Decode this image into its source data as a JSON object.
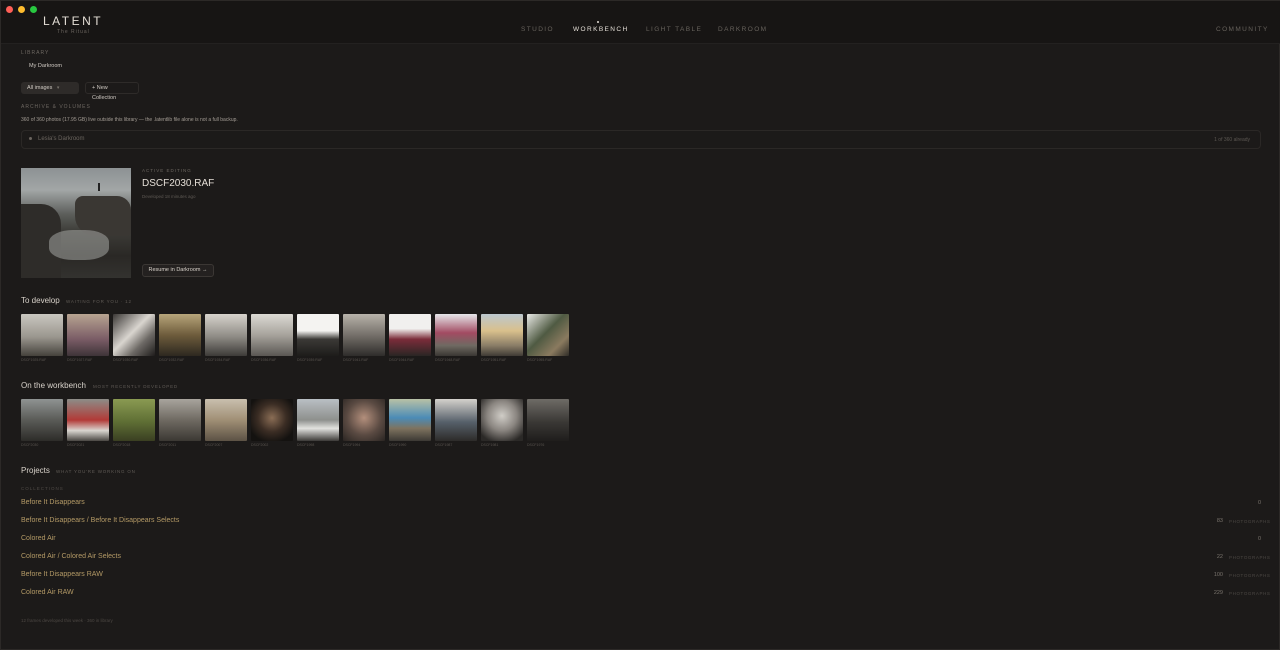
{
  "app": {
    "name": "LATENT",
    "subtitle": "The Ritual"
  },
  "nav": {
    "items": [
      "STUDIO",
      "WORKBENCH",
      "LIGHT TABLE",
      "DARKROOM"
    ],
    "active": "WORKBENCH",
    "right": "COMMUNITY"
  },
  "library": {
    "label": "LIBRARY",
    "selected": "My Darkroom",
    "filter": "All images",
    "new_collection": "+ New Collection"
  },
  "archive": {
    "label": "ARCHIVE & VOLUMES",
    "note": "360 of 360 photos (17.95 GB) live outside this library — the .latentlib file alone is not a full backup.",
    "volume_name": "Lesia's Darkroom",
    "volume_count": "1 of 360 already"
  },
  "active": {
    "label": "ACTIVE EDITING",
    "filename": "DSCF2030.RAF",
    "meta": "Developed 18 minutes ago",
    "resume_label": "Resume in Darkroom →"
  },
  "to_develop": {
    "title": "To develop",
    "subtitle": "WAITING FOR YOU · 12",
    "captions": [
      "DSCF1925.RAF",
      "DSCF1927.RAF",
      "DSCF1930.RAF",
      "DSCF1932.RAF",
      "DSCF1934.RAF",
      "DSCF1936.RAF",
      "DSCF1939.RAF",
      "DSCF1941.RAF",
      "DSCF1944.RAF",
      "DSCF1948.RAF",
      "DSCF1951.RAF",
      "DSCF1955.RAF"
    ]
  },
  "workbench": {
    "title": "On the workbench",
    "subtitle": "MOST RECENTLY DEVELOPED",
    "captions": [
      "DSCF2030",
      "DSCF2021",
      "DSCF2018",
      "DSCF2011",
      "DSCF2007",
      "DSCF2002",
      "DSCF1998",
      "DSCF1994",
      "DSCF1990",
      "DSCF1987",
      "DSCF1981",
      "DSCF1976"
    ]
  },
  "projects": {
    "title": "Projects",
    "subtitle": "WHAT YOU'RE WORKING ON",
    "collections_label": "COLLECTIONS",
    "unit": "PHOTOGRAPHS",
    "items": [
      {
        "name": "Before It Disappears",
        "count": "0"
      },
      {
        "name": "Before It Disappears / Before It Disappears Selects",
        "count": "83"
      },
      {
        "name": "Colored Air",
        "count": "0"
      },
      {
        "name": "Colored Air / Colored Air Selects",
        "count": "22"
      },
      {
        "name": "Before It Disappears RAW",
        "count": "100"
      },
      {
        "name": "Colored Air RAW",
        "count": "229"
      }
    ]
  },
  "footer": "12 frames developed this week · 360 in library",
  "colors": {
    "accent_gold": "#b49a66",
    "bg": "#1c1a19",
    "traffic_red": "#ff5f57",
    "traffic_yellow": "#febc2e",
    "traffic_green": "#28c840"
  }
}
